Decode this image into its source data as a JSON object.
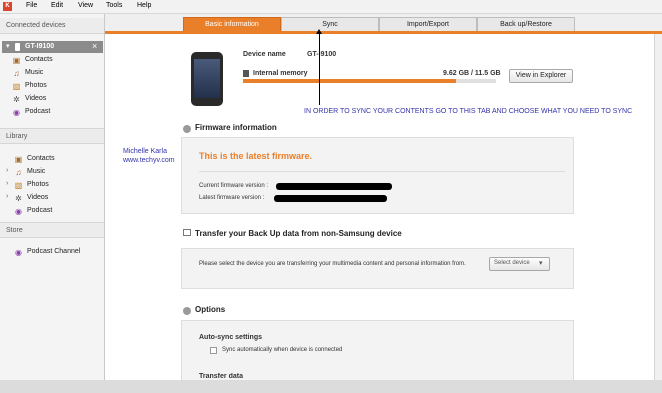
{
  "menubar": {
    "items": [
      "File",
      "Edit",
      "View",
      "Tools",
      "Help"
    ]
  },
  "sidebar": {
    "connected_title": "Connected devices",
    "device_name": "GT-I9100",
    "device_items": [
      "Contacts",
      "Music",
      "Photos",
      "Videos",
      "Podcast"
    ],
    "library_title": "Library",
    "library_items": [
      "Contacts",
      "Music",
      "Photos",
      "Videos",
      "Podcast"
    ],
    "store_title": "Store",
    "store_items": [
      "Podcast Channel"
    ]
  },
  "tabs": [
    "Basic information",
    "Sync",
    "Import/Export",
    "Back up/Restore"
  ],
  "device": {
    "name_label": "Device name",
    "name_value": "GT-I9100",
    "memory_label": "Internal memory",
    "memory_value": "9.62 GB / 11.5 GB",
    "memory_used_fraction": 0.84,
    "explorer_button": "View in Explorer"
  },
  "annotation": {
    "instruction": "IN ORDER TO SYNC YOUR CONTENTS GO TO THIS TAB AND CHOOSE WHAT YOU NEED TO SYNC",
    "author": "Michelle Karla",
    "site": "www.techyv.com"
  },
  "firmware": {
    "title": "Firmware information",
    "status": "This is the latest firmware.",
    "current_label": "Current firmware version :",
    "latest_label": "Latest firmware version :"
  },
  "transfer": {
    "title": "Transfer your Back Up data from non-Samsung device",
    "description": "Please select the device you are transferring your multimedia content and personal information from.",
    "select_placeholder": "Select device"
  },
  "options": {
    "title": "Options",
    "autosync_title": "Auto-sync settings",
    "autosync_checkbox": "Sync automatically when device is connected",
    "next_title": "Transfer data"
  },
  "colors": {
    "accent": "#ea7f2a",
    "annotation": "#3333aa"
  }
}
